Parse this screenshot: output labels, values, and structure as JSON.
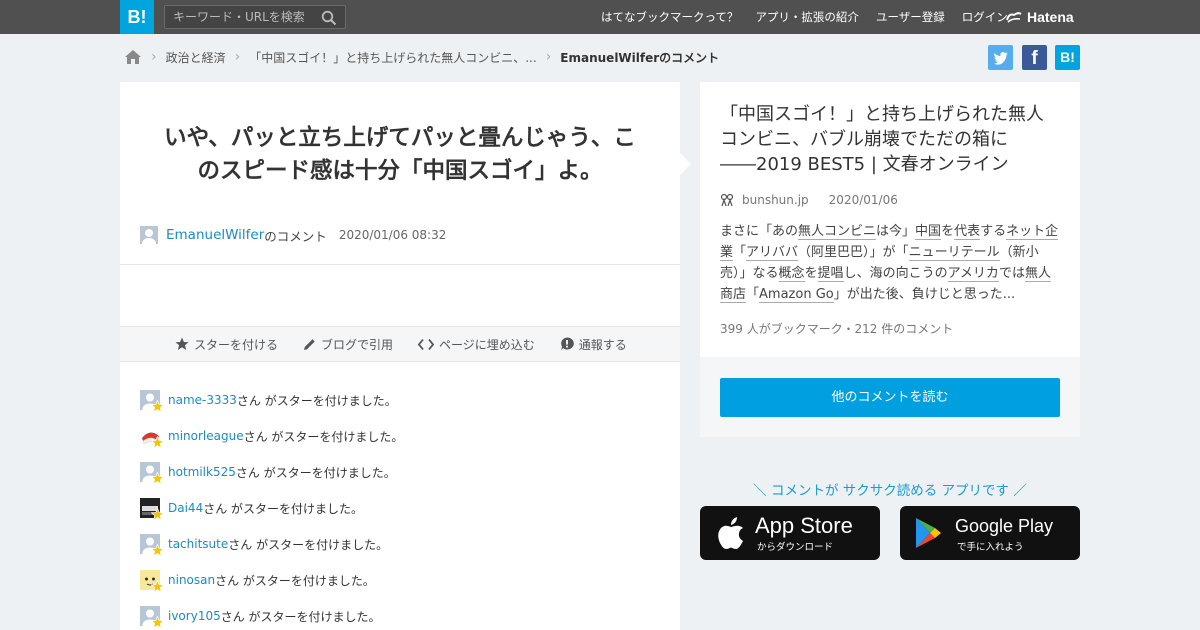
{
  "header": {
    "logo": "B!",
    "search_placeholder": "キーワード・URLを検索",
    "nav": [
      "はてなブックマークって？",
      "アプリ・拡張の紹介",
      "ユーザー登録",
      "ログイン"
    ],
    "brand": "Hatena"
  },
  "breadcrumb": {
    "category": "政治と経済",
    "article": "「中国スゴイ！」と持ち上げられた無人コンビニ、...",
    "current": "EmanuelWilferのコメント"
  },
  "comment": {
    "text_line1": "いや、パッと立ち上げてパッと畳んじゃう、こ",
    "text_line2": "のスピード感は十分「中国スゴイ」よ。",
    "user": "EmanuelWilfer",
    "user_suffix": "のコメント",
    "timestamp": "2020/01/06 08:32"
  },
  "actions": {
    "star": "スターを付ける",
    "blog": "ブログで引用",
    "embed": "ページに埋め込む",
    "report": "通報する"
  },
  "stars": {
    "suffix": "さん がスターを付けました。",
    "users": [
      "name-3333",
      "minorleague",
      "hotmilk525",
      "Dai44",
      "tachitsute",
      "ninosan",
      "ivory105"
    ]
  },
  "article": {
    "title_line1": "「中国スゴイ！」と持ち上げられた無人",
    "title_line2": "コンビニ、バブル崩壊でただの箱に",
    "title_line3": "――2019 BEST5 | 文春オンライン",
    "domain": "bunshun.jp",
    "date": "2020/01/06",
    "desc": {
      "p1": "まさに「あの",
      "k1": "無人コンビニ",
      "p2": "は今」",
      "k2": "中国",
      "p3": "を",
      "k3": "代表",
      "p4": "する",
      "k4": "ネット企業",
      "p5": "「",
      "k5": "アリババ",
      "p6": "（阿里巴巴）」が「",
      "k6": "ニューリテール",
      "p7": "（新小売）」なる",
      "k7": "概念",
      "p8": "を",
      "k8": "提唱",
      "p9": "し、海の向こうの",
      "k9": "アメリカ",
      "p10": "では",
      "k10": "無人商店",
      "p11": "「",
      "k11": "Amazon Go",
      "p12": "」が出た後、負けじと思った..."
    },
    "stats": "399 人がブックマーク・212 件のコメント",
    "read_more": "他のコメントを読む"
  },
  "promo": {
    "text": "＼ コメントが サクサク読める アプリです ／",
    "appstore_big": "App Store",
    "appstore_small": "からダウンロード",
    "googleplay_big": "Google Play",
    "googleplay_small": "で手に入れよう"
  },
  "colors": {
    "header_bg": "#505050",
    "logo_bg": "#00a4de",
    "link": "#1b8bc3",
    "button": "#00a0e0",
    "twitter": "#55acee",
    "facebook": "#3b5998",
    "hatena": "#00a4de",
    "star": "#f5c400"
  }
}
